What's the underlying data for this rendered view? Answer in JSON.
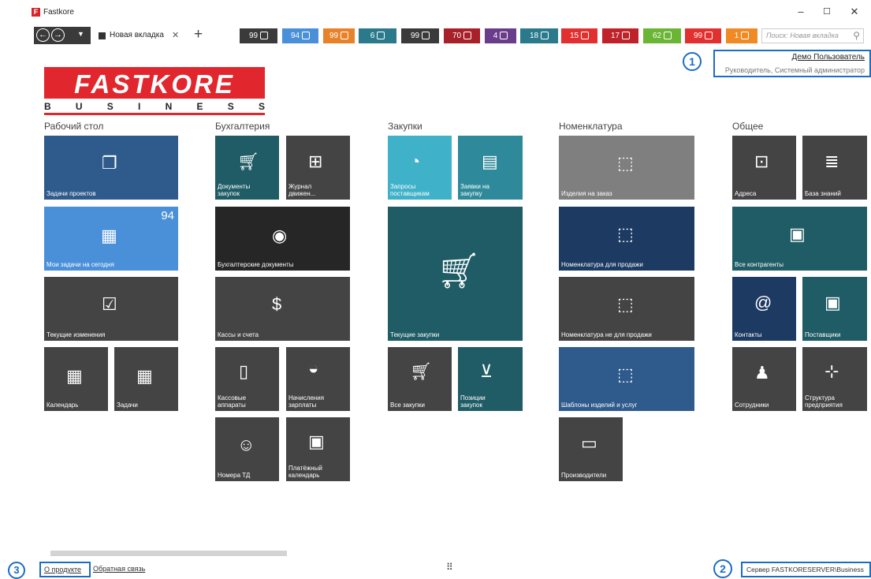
{
  "window": {
    "title": "Fastkore",
    "logo_letter": "F",
    "minimize": "–",
    "maximize": "☐",
    "close": "✕"
  },
  "tabs": {
    "active_label": "Новая вкладка",
    "close": "✕",
    "add": "+"
  },
  "badges": [
    {
      "count": "99",
      "color": "#3a3a3a",
      "icon": "grid-icon"
    },
    {
      "count": "94",
      "color": "#4a90d9",
      "icon": "calendar-icon"
    },
    {
      "count": "99",
      "color": "#e8822a",
      "icon": "face-icon"
    },
    {
      "count": "6",
      "color": "#2a7a8c",
      "icon": "face-icon"
    },
    {
      "count": "99",
      "color": "#3a3a3a",
      "icon": "chart-icon"
    },
    {
      "count": "70",
      "color": "#a8202a",
      "icon": "list-icon"
    },
    {
      "count": "4",
      "color": "#6a3d8a",
      "icon": "truck-icon"
    },
    {
      "count": "18",
      "color": "#2a7a8c",
      "icon": "cart-icon"
    },
    {
      "count": "15",
      "color": "#e23030",
      "icon": "calendar-icon"
    },
    {
      "count": "17",
      "color": "#c0222a",
      "icon": "face-icon"
    },
    {
      "count": "62",
      "color": "#6ab534",
      "icon": "cart-icon"
    },
    {
      "count": "99",
      "color": "#e23030",
      "icon": "face-icon"
    },
    {
      "count": "1",
      "color": "#f08a24",
      "icon": "clock-icon"
    }
  ],
  "search": {
    "placeholder": "Поиск: Новая вкладка",
    "icon": "⚲"
  },
  "user": {
    "name": "Демо Пользователь",
    "role": "Руководитель, Системный администратор"
  },
  "callouts": {
    "one": "1",
    "two": "2",
    "three": "3"
  },
  "logo": {
    "main": "FASTKORE",
    "sub": [
      "B",
      "U",
      "S",
      "I",
      "N",
      "E",
      "S",
      "S"
    ]
  },
  "groups": {
    "desk": "Рабочий стол",
    "accounting": "Бухгалтерия",
    "purchases": "Закупки",
    "nomenclature": "Номенклатура",
    "general": "Общее"
  },
  "tiles": {
    "project_tasks": "Задачи проектов",
    "today_tasks": "Мои задачи на сегодня",
    "today_count": "94",
    "current_changes": "Текущие изменения",
    "calendar": "Календарь",
    "tasks": "Задачи",
    "purchase_docs": "Документы закупок",
    "journal": "Журнал движен...",
    "acc_docs": "Бухгалтерские документы",
    "cash": "Кассы и счета",
    "cash_devices": "Кассовые аппараты",
    "salary": "Начисления зарплаты",
    "td_numbers": "Номера ТД",
    "pay_calendar": "Платёжный календарь",
    "supplier_requests": "Запросы поставщикам",
    "purchase_requests": "Заявки на закупку",
    "current_purchases": "Текущие закупки",
    "all_purchases": "Все закупки",
    "purchase_items": "Позиции закупок",
    "made_to_order": "Изделия на заказ",
    "for_sale": "Номенклатура для продажи",
    "not_for_sale": "Номенклатура не для продажи",
    "templates": "Шаблоны изделий и услуг",
    "manufacturers": "Производители",
    "addresses": "Адреса",
    "knowledge": "База знаний",
    "counterparties": "Все контрагенты",
    "contacts": "Контакты",
    "suppliers": "Поставщики",
    "employees": "Сотрудники",
    "structure": "Структура предприятия"
  },
  "footer": {
    "about": "О продукте",
    "feedback": "Обратная связь",
    "server": "Сервер FASTKORESERVER\\Business",
    "grid": "⠿"
  }
}
